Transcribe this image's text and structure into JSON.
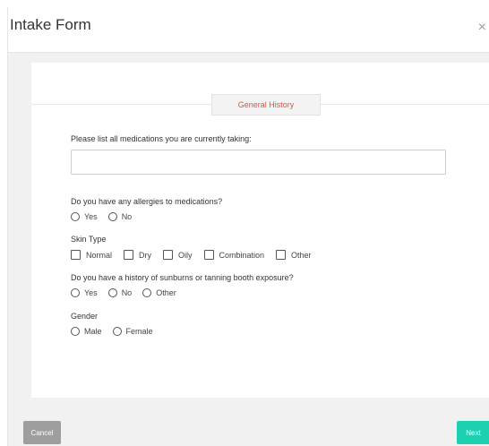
{
  "modal": {
    "title": "Intake Form",
    "close_glyph": "×"
  },
  "section": {
    "label": "General History"
  },
  "medications": {
    "question": "Please list all medications you are currently taking:",
    "value": "",
    "placeholder": ""
  },
  "allergies": {
    "question": "Do you have any allergies to medications?",
    "options": [
      "Yes",
      "No"
    ]
  },
  "skin_type": {
    "question": "Skin Type",
    "options": [
      "Normal",
      "Dry",
      "Oily",
      "Combination",
      "Other"
    ]
  },
  "sunburns": {
    "question": "Do you have a history of sunburns or tanning booth exposure?",
    "options": [
      "Yes",
      "No",
      "Other"
    ]
  },
  "gender": {
    "question": "Gender",
    "options": [
      "Male",
      "Female"
    ]
  },
  "footer": {
    "cancel_label": "Cancel",
    "next_label": "Next"
  },
  "colors": {
    "accent": "#1dd0b0",
    "section_text": "#d9534f",
    "cancel": "#9e9e9e"
  }
}
